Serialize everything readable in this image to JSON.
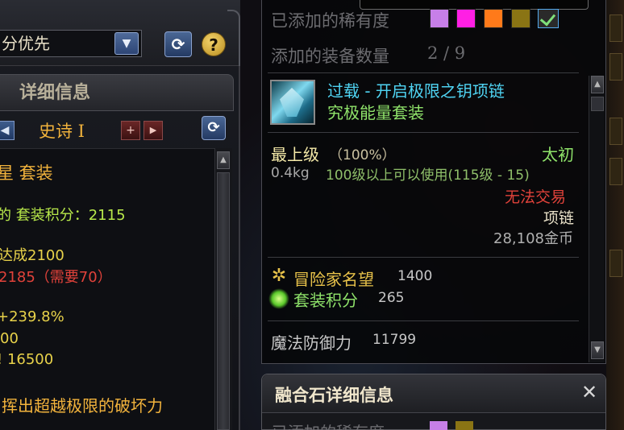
{
  "left_panel": {
    "sort_dropdown": {
      "value": "分优先",
      "arrow_icon": "chevron-down-icon"
    },
    "refresh_icon": "refresh-icon",
    "help_label": "?",
    "detail_header": "详细信息",
    "grade": {
      "prev_label": "◀",
      "label": "史诗 Ⅰ",
      "plus_label": "+",
      "next_label": "▶"
    },
    "lines": {
      "set_title": "星 套装",
      "set_points": "的 套装积分：2115",
      "achieved": "达成2100",
      "need": "2185（需要70）",
      "percent": "+239.8%",
      "value_00": "00",
      "value_16500": "! 16500",
      "effect": "挥出超越极限的破坏力"
    }
  },
  "item_panel": {
    "rarity_label": "已添加的稀有度",
    "rarity_colors": [
      "#c77fe8",
      "#ff1fe4",
      "#ff7a1a",
      "#8a7414"
    ],
    "equip_count_label": "添加的装备数量",
    "equip_count_value": "2 / 9",
    "item_name": "过载 - 开启极限之钥项链",
    "item_set": "究极能量套装",
    "grade": "最上级",
    "grade_percent": "（100%）",
    "grade_tag": "太初",
    "weight": "0.4kg",
    "level_req": "100级以上可以使用(115级 - 15)",
    "trade": "无法交易",
    "slot": "项链",
    "price": "28,108金币",
    "fame_label": "冒险家名望",
    "fame_value": "1400",
    "set_points_label": "套装积分",
    "set_points_value": "265",
    "magic_def_label": "魔法防御力",
    "magic_def_value": "11799"
  },
  "fusion_panel": {
    "title": "融合石详细信息",
    "close_label": "✕",
    "rarity_label": "已添加的稀有度"
  },
  "colors": {
    "gold": "#f2b33c",
    "name_cyan": "#4fd3f2",
    "set_green": "#8fe36a",
    "red": "#e0423a",
    "yellow": "#e8c24a"
  }
}
